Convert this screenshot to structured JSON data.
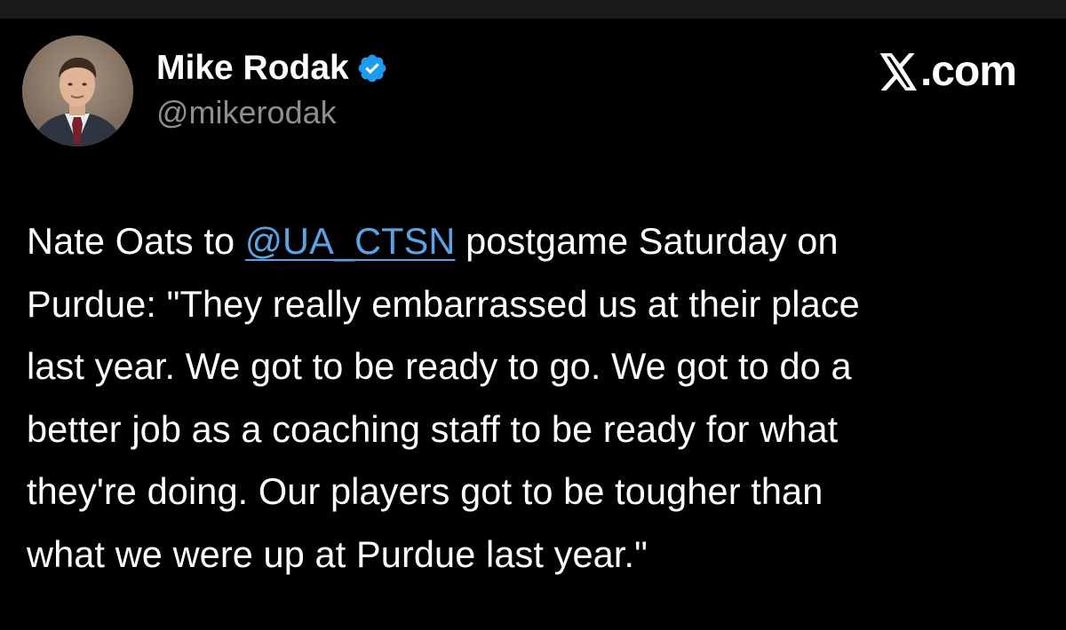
{
  "author": {
    "display_name": "Mike Rodak",
    "handle": "@mikerodak",
    "verified": true
  },
  "brand": {
    "icon": "x-logo-icon",
    "text": ".com"
  },
  "tweet": {
    "lines": [
      {
        "before": "Nate Oats to ",
        "mention": "@UA_CTSN",
        "after": " postgame Saturday on"
      },
      {
        "text": "Purdue: \"They really embarrassed us at their place"
      },
      {
        "text": "last year. We got to be ready to go. We got to do a"
      },
      {
        "text": "better job as a coaching staff to be ready for what"
      },
      {
        "text": "they're doing. Our players got to be tougher than"
      },
      {
        "text": "what we were up at Purdue last year.\""
      }
    ]
  },
  "colors": {
    "background": "#000000",
    "text": "#ffffff",
    "handle": "#8b8f94",
    "mention": "#5aa4e6",
    "verified_badge": "#1d9bf0"
  }
}
